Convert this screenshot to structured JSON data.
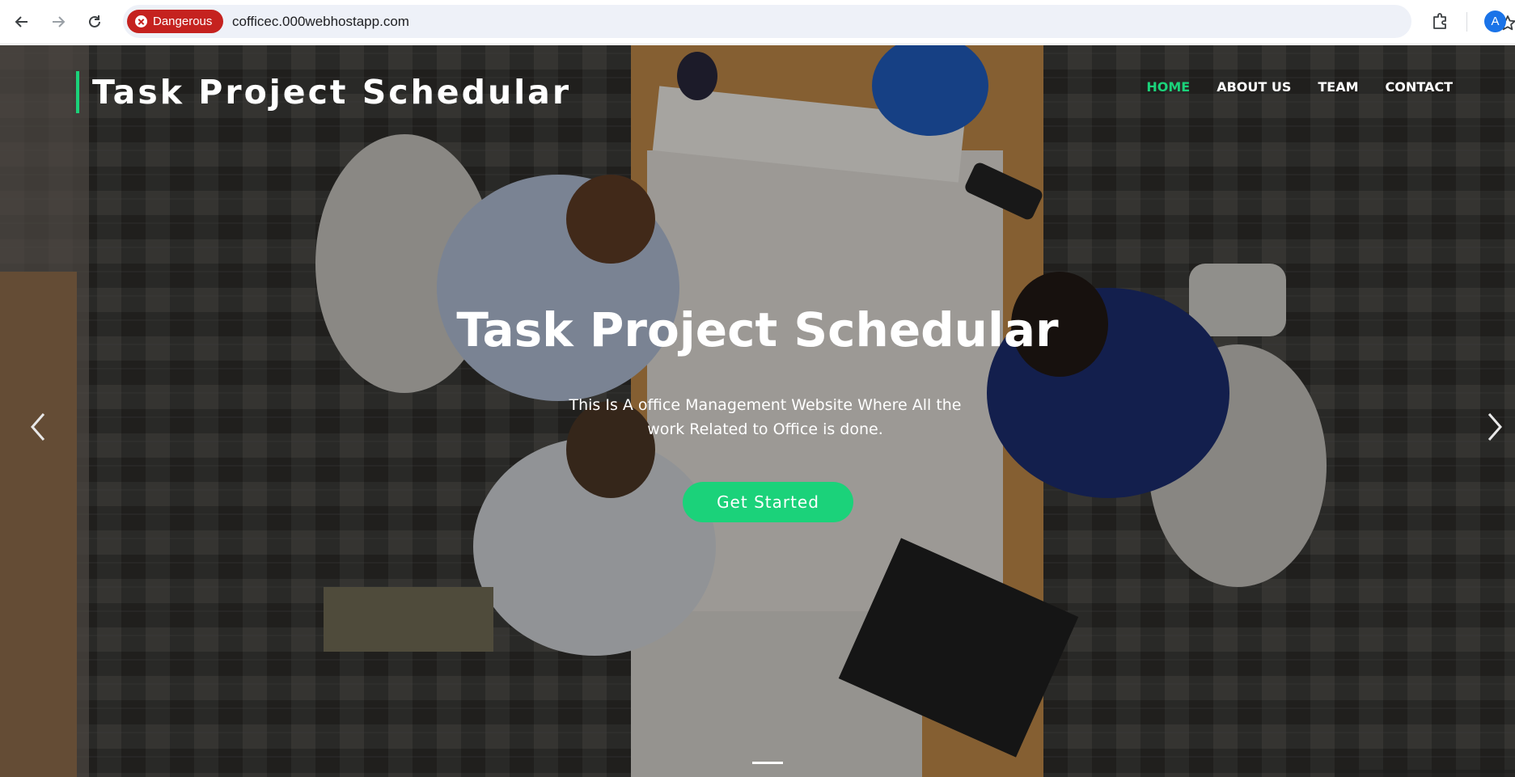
{
  "browser": {
    "security_label": "Dangerous",
    "url": "cofficec.000webhostapp.com",
    "profile_initial": "A",
    "icons": {
      "back": "arrow-left-icon",
      "forward": "arrow-right-icon",
      "reload": "reload-icon",
      "danger": "x-circle-icon",
      "bookmark": "star-icon",
      "extensions": "puzzle-icon"
    },
    "colors": {
      "danger": "#c5221f",
      "omnibox": "#eef1f8",
      "profile": "#1a73e8"
    }
  },
  "site": {
    "logo": "Task Project Schedular",
    "nav": [
      {
        "label": "HOME",
        "active": true
      },
      {
        "label": "ABOUT US",
        "active": false
      },
      {
        "label": "TEAM",
        "active": false
      },
      {
        "label": "CONTACT",
        "active": false
      }
    ],
    "hero": {
      "title": "Task Project Schedular",
      "subtitle": "This Is A office Management Website Where All the work Related to Office is done.",
      "cta_label": "Get Started",
      "prev_icon": "chevron-left-icon",
      "next_icon": "chevron-right-icon",
      "background": "office team working at a table with blueprints, laptop and hard hat"
    },
    "colors": {
      "accent": "#1bd27a",
      "text": "#ffffff"
    }
  }
}
